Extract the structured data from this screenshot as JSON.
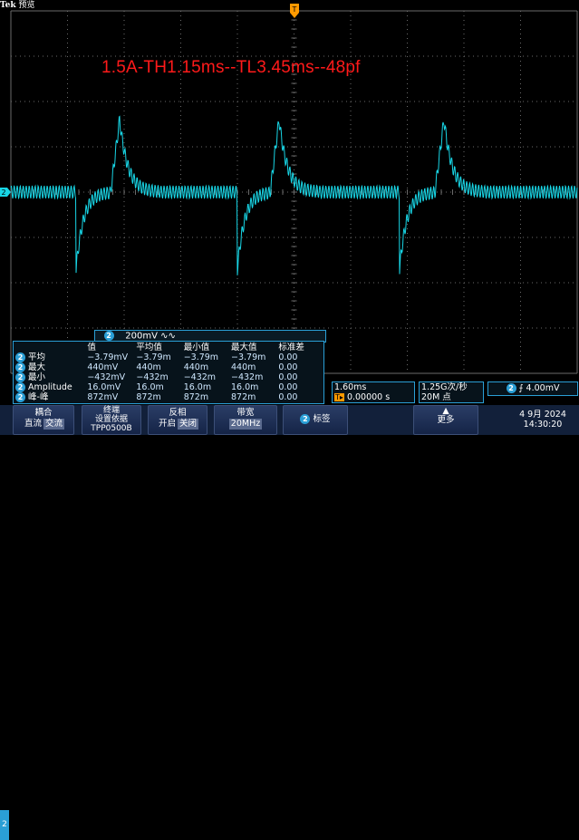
{
  "top": {
    "brand": "Tek",
    "mode": "预览"
  },
  "annotation": "1.5A-TH1.15ms--TL3.45ms--48pf",
  "channel": {
    "num": "2",
    "scale": "200mV",
    "coupling_icon": "∿∿"
  },
  "measurements": {
    "headers": [
      "值",
      "平均值",
      "最小值",
      "最大值",
      "标准差"
    ],
    "rows": [
      {
        "ch": "2",
        "label": "平均",
        "values": [
          "−3.79mV",
          "−3.79m",
          "−3.79m",
          "−3.79m",
          "0.00"
        ]
      },
      {
        "ch": "2",
        "label": "最大",
        "values": [
          "440mV",
          "440m",
          "440m",
          "440m",
          "0.00"
        ]
      },
      {
        "ch": "2",
        "label": "最小",
        "values": [
          "−432mV",
          "−432m",
          "−432m",
          "−432m",
          "0.00"
        ]
      },
      {
        "ch": "2",
        "label": "Amplitude",
        "values": [
          "16.0mV",
          "16.0m",
          "16.0m",
          "16.0m",
          "0.00"
        ]
      },
      {
        "ch": "2",
        "label": "峰-峰",
        "values": [
          "872mV",
          "872m",
          "872m",
          "872m",
          "0.00"
        ]
      }
    ]
  },
  "timebase": {
    "scale": "1.60ms",
    "delay": "0.00000 s"
  },
  "acq": {
    "rate": "1.25G次/秒",
    "points": "20M 点"
  },
  "trigger": {
    "ch": "2",
    "slope_icon": "⨍",
    "level": "4.00mV"
  },
  "menu": {
    "side": "2",
    "coupling": {
      "title": "耦合",
      "opt1": "直流",
      "opt2": "交流"
    },
    "termination": {
      "title": "终端",
      "sub": "设置依据",
      "value": "TPP0500B"
    },
    "invert": {
      "title": "反相",
      "opt1": "开启",
      "opt2": "关闭"
    },
    "bandwidth": {
      "title": "带宽",
      "value": "20MHz"
    },
    "label": {
      "ch": "2",
      "text": "标签"
    },
    "more": {
      "text": "更多"
    }
  },
  "datetime": {
    "date": "4 9月 2024",
    "time": "14:30:20"
  },
  "colors": {
    "trace": "#18d6e6",
    "grid": "#6a6a6a",
    "accent": "#2a9fd6",
    "annotation": "#ff1a1a"
  }
}
